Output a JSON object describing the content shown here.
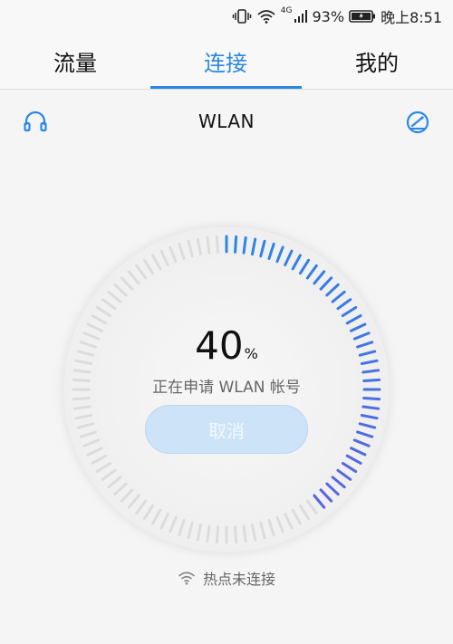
{
  "status_bar": {
    "network": "4G",
    "battery": "93%",
    "time": "晚上8:51"
  },
  "tabs": [
    {
      "label": "流量"
    },
    {
      "label": "连接"
    },
    {
      "label": "我的"
    }
  ],
  "header": {
    "title": "WLAN",
    "left_icon": "headset-icon",
    "right_icon": "speed-gauge-icon"
  },
  "progress": {
    "value": "40",
    "unit": "%",
    "fraction": 0.4,
    "status": "正在申请 WLAN 帐号"
  },
  "actions": {
    "cancel_label": "取消"
  },
  "footer": {
    "hotspot_status": "热点未连接"
  },
  "colors": {
    "accent": "#2a87e6",
    "tick_active_start": "#2a87e6",
    "tick_active_end": "#5b64df",
    "tick_inactive": "#dcdcdc",
    "button_bg": "#cde3f8"
  }
}
